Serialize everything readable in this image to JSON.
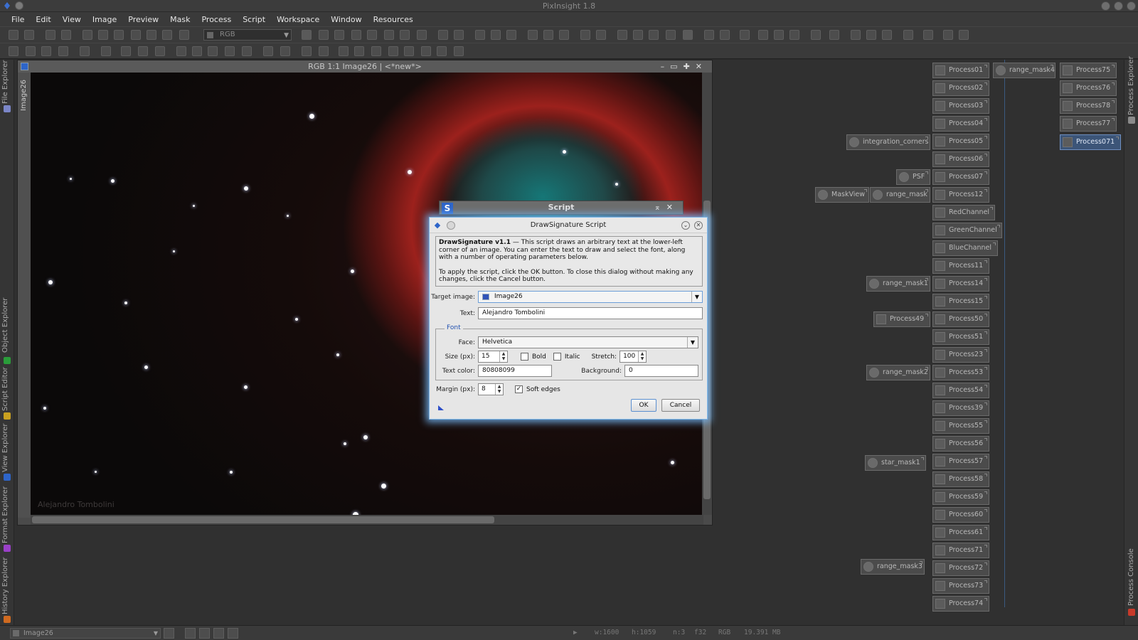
{
  "app": {
    "title": "PixInsight 1.8"
  },
  "menu": [
    "File",
    "Edit",
    "View",
    "Image",
    "Preview",
    "Mask",
    "Process",
    "Script",
    "Workspace",
    "Window",
    "Resources"
  ],
  "toolbar": {
    "color_space": "RGB"
  },
  "left_tabs": [
    "File Explorer",
    "Object Explorer",
    "Script Editor",
    "View Explorer",
    "Format Explorer",
    "History Explorer"
  ],
  "right_tabs": [
    "Process Explorer",
    "Process Console"
  ],
  "image_window": {
    "title": "RGB 1:1 Image26 | <*new*>",
    "side_tab": "Image26",
    "signature": "Alejandro Tombolini"
  },
  "script_dialog": {
    "title": "Script"
  },
  "dialog": {
    "title": "DrawSignature Script",
    "info_heading": "DrawSignature v1.1",
    "info_text": " — This script draws an arbitrary text at the lower-left corner of an image. You can enter the text to draw and select the font, along with a number of operating parameters below.",
    "info_text2": "To apply the script, click the OK button. To close this dialog without making any changes, click the Cancel button.",
    "target_label": "Target image:",
    "target_value": "Image26",
    "text_label": "Text:",
    "text_value": "Alejandro Tombolini",
    "font_legend": "Font",
    "face_label": "Face:",
    "face_value": "Helvetica",
    "size_label": "Size (px):",
    "size_value": "15",
    "bold_label": "Bold",
    "italic_label": "Italic",
    "stretch_label": "Stretch:",
    "stretch_value": "100",
    "textcolor_label": "Text color:",
    "textcolor_value": "80808099",
    "background_label": "Background:",
    "background_value": "0",
    "margin_label": "Margin (px):",
    "margin_value": "8",
    "soft_edges_label": "Soft edges",
    "ok_label": "OK",
    "cancel_label": "Cancel"
  },
  "process_icons": {
    "col1": [
      "Process01",
      "Process02",
      "Process03",
      "Process04",
      "Process05",
      "Process06",
      "Process07",
      "Process12",
      "RedChannel",
      "GreenChannel",
      "BlueChannel",
      "Process11",
      "Process14",
      "Process15",
      "Process50",
      "Process51",
      "Process23",
      "Process53",
      "Process54",
      "Process39",
      "Process55",
      "Process56",
      "Process57",
      "Process58",
      "Process59",
      "Process60",
      "Process61",
      "Process71",
      "Process72",
      "Process73",
      "Process74"
    ],
    "col2": [
      "Process75",
      "Process76",
      "Process78",
      "Process77",
      "Process071"
    ],
    "floating": {
      "range_mask4": "range_mask4",
      "integration_corners": "integration_corners",
      "psf": "PSF",
      "maskview": "MaskView",
      "range_mask": "range_mask",
      "range_mask1": "range_mask1",
      "process49": "Process49",
      "range_mask2": "range_mask2",
      "star_mask1": "star_mask1",
      "range_mask3": "range_mask3"
    }
  },
  "status": {
    "view": "Image26",
    "width": "w:1600",
    "height": "h:1059",
    "channels": "n:3",
    "format": "f32",
    "space": "RGB",
    "size": "19.391 MB"
  }
}
